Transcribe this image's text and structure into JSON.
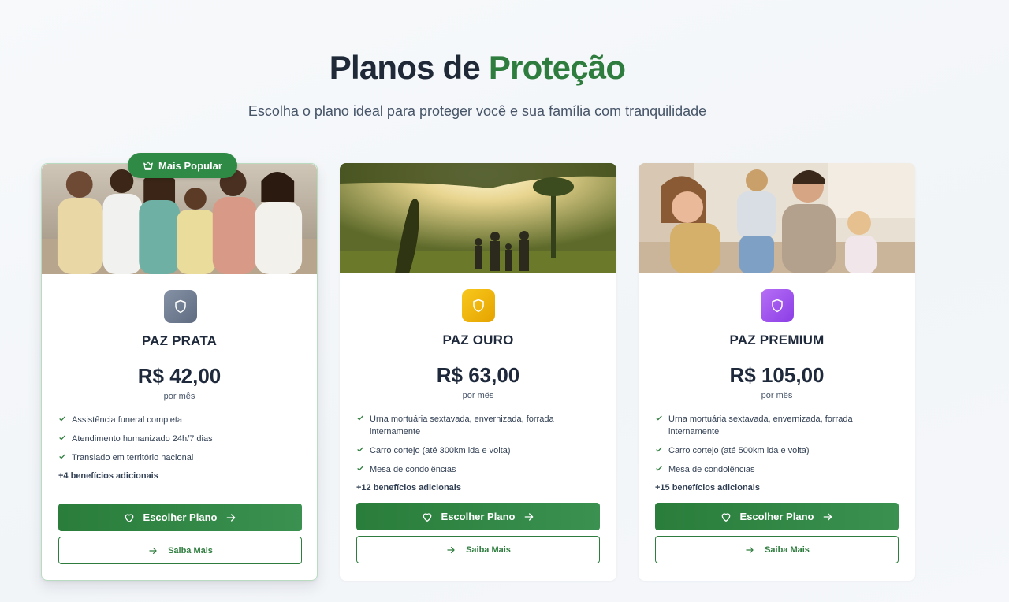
{
  "header": {
    "title_part1": "Planos de",
    "title_accent": "Proteção",
    "subtitle": "Escolha o plano ideal para proteger você e sua família com tranquilidade"
  },
  "colors": {
    "brand_green": "#2e7d3e",
    "prata_icon": "#6b7890",
    "ouro_icon": "#f0b400",
    "premium_icon": "#a855f7"
  },
  "plans": [
    {
      "badge": "Mais Popular",
      "name": "PAZ PRATA",
      "price": "R$ 42,00",
      "period": "por mês",
      "features": [
        "Assistência funeral completa",
        "Atendimento humanizado 24h/7 dias",
        "Translado em território nacional"
      ],
      "extra": "+4 benefícios adicionais",
      "choose_label": "Escolher Plano",
      "more_label": "Saiba Mais",
      "photo": "family-on-couch-photo"
    },
    {
      "name": "PAZ OURO",
      "price": "R$ 63,00",
      "period": "por mês",
      "features": [
        "Urna mortuária sextavada, envernizada, forrada internamente",
        "Carro cortejo (até 300km ida e volta)",
        "Mesa de condolências"
      ],
      "extra": "+12 benefícios adicionais",
      "choose_label": "Escolher Plano",
      "more_label": "Saiba Mais",
      "photo": "family-park-sunset-photo"
    },
    {
      "name": "PAZ PREMIUM",
      "price": "R$ 105,00",
      "period": "por mês",
      "features": [
        "Urna mortuária sextavada, envernizada, forrada internamente",
        "Carro cortejo (até 500km ida e volta)",
        "Mesa de condolências"
      ],
      "extra": "+15 benefícios adicionais",
      "choose_label": "Escolher Plano",
      "more_label": "Saiba Mais",
      "photo": "family-playing-home-photo"
    }
  ]
}
